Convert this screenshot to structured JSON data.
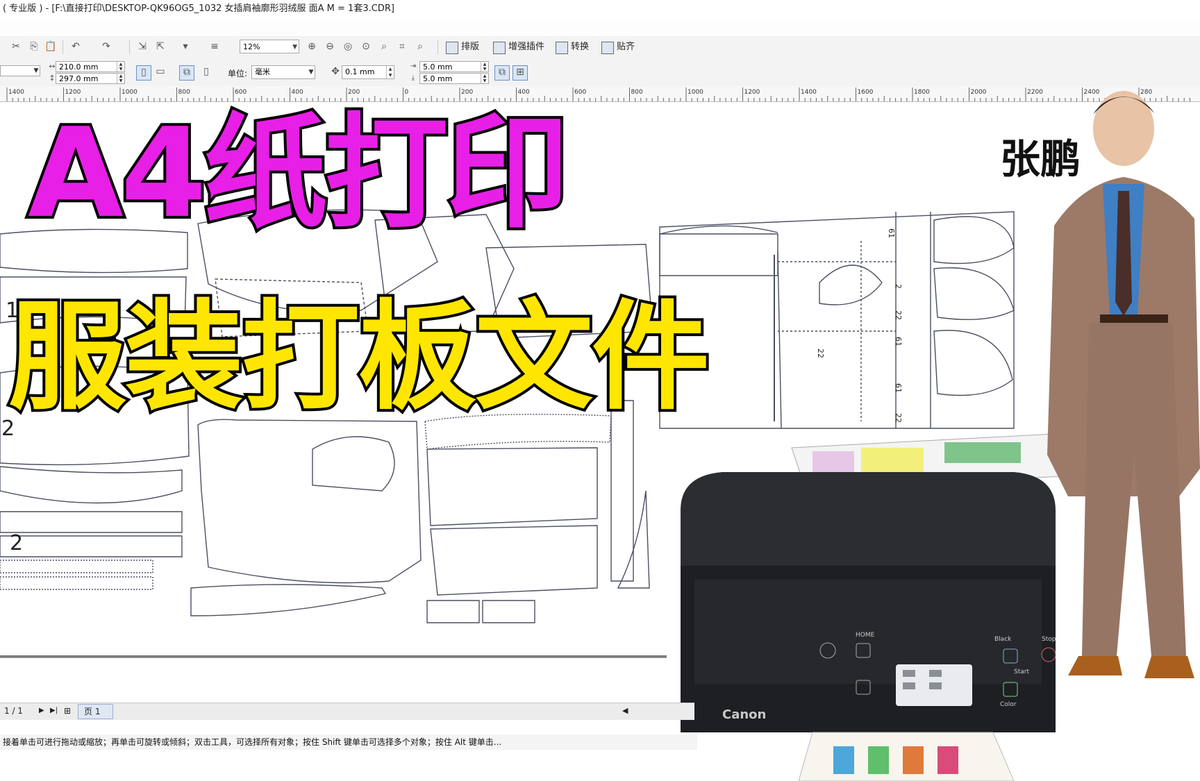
{
  "window": {
    "title": "( 专业版 ) - [F:\\直接打印\\DESKTOP-QK96OG5_1032 女插肩袖廓形羽绒服  面A  M = 1套3.CDR]"
  },
  "toolbar1": {
    "zoom_value": "12%",
    "buttons": [
      "排版",
      "增强插件",
      "转换",
      "贴齐"
    ]
  },
  "toolbar2": {
    "width": "210.0 mm",
    "height": "297.0 mm",
    "unit_label": "单位:",
    "unit_value": "毫米",
    "nudge": "0.1 mm",
    "dup_x": "5.0 mm",
    "dup_y": "5.0 mm"
  },
  "ruler": {
    "ticks": [
      "1400",
      "1200",
      "1000",
      "800",
      "600",
      "400",
      "200",
      "0",
      "200",
      "400",
      "600",
      "800",
      "1000",
      "1200",
      "1400",
      "1600",
      "1800",
      "2000",
      "2200",
      "2400",
      "280"
    ]
  },
  "overlay": {
    "headline_line1": "A4纸打印",
    "headline_line2": "服装打板文件",
    "author": "张鹏"
  },
  "pattern": {
    "markers": [
      "1",
      "2",
      "2"
    ],
    "piece_numbers": [
      "61",
      "2",
      "22",
      "61",
      "22",
      "61",
      "22"
    ],
    "printer_brand": "Canon",
    "printer_labels": [
      "HOME",
      "Black",
      "Stop",
      "Start",
      "Color"
    ]
  },
  "status": {
    "page_count": "1 / 1",
    "page_tab": "页 1",
    "hint": "接着单击可进行拖动或缩放；再单击可旋转或倾斜；双击工具，可选择所有对象；按住 Shift 键单击可选择多个对象；按住 Alt 键单击..."
  },
  "colors": {
    "headline1": "#e81fe6",
    "headline2": "#ffe600",
    "outline": "#000000",
    "suit": "#9c7a67",
    "shirt": "#3f7fc4",
    "printer": "#2b2d31"
  }
}
